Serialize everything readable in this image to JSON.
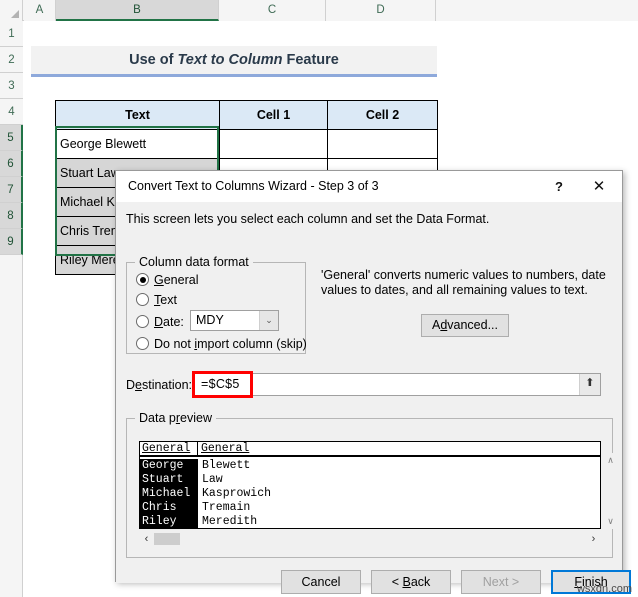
{
  "spreadsheet": {
    "column_headers": [
      "A",
      "B",
      "C",
      "D"
    ],
    "selected_column": "B",
    "row_headers": [
      "1",
      "2",
      "3",
      "4",
      "5",
      "6",
      "7",
      "8",
      "9"
    ],
    "selected_rows": [
      "5",
      "6",
      "7",
      "8",
      "9"
    ],
    "title_banner": {
      "prefix": "Use of ",
      "italic": "Text to Column",
      "suffix": " Feature"
    },
    "table": {
      "headers": [
        "Text",
        "Cell 1",
        "Cell 2"
      ],
      "rows": [
        {
          "text": "George Blewett",
          "cell1": "",
          "cell2": "",
          "selected": false
        },
        {
          "text": "Stuart Law",
          "cell1": "",
          "cell2": "",
          "selected": true
        },
        {
          "text": "Michael Kasprowich",
          "cell1": "",
          "cell2": "",
          "selected": true
        },
        {
          "text": "Chris Tremain",
          "cell1": "",
          "cell2": "",
          "selected": true
        },
        {
          "text": "Riley Meredith",
          "cell1": "",
          "cell2": "",
          "selected": true
        }
      ]
    }
  },
  "dialog": {
    "title": "Convert Text to Columns Wizard - Step 3 of 3",
    "help_icon": "?",
    "close_icon": "✕",
    "intro": "This screen lets you select each column and set the Data Format.",
    "column_data_format": {
      "legend": "Column data format",
      "options": [
        {
          "label_before": "",
          "access_key": "G",
          "label_after": "eneral",
          "selected": true
        },
        {
          "label_before": "",
          "access_key": "T",
          "label_after": "ext",
          "selected": false
        },
        {
          "label_before": "",
          "access_key": "D",
          "label_after": "ate:",
          "selected": false
        },
        {
          "label_before": "Do not ",
          "access_key": "i",
          "label_after": "mport column (skip)",
          "selected": false
        }
      ],
      "date_format_value": "MDY",
      "date_format_arrow": "⌄"
    },
    "format_description": "'General' converts numeric values to numbers, date values to dates, and all remaining values to text.",
    "advanced_button": {
      "label_before": "A",
      "access_key": "d",
      "label_after": "vanced..."
    },
    "destination": {
      "label_before": "D",
      "access_key": "e",
      "label_after": "stination:",
      "value": "=$C$5",
      "picker_icon": "⬆",
      "highlight_color": "#ff0000"
    },
    "data_preview": {
      "legend_before": "Data p",
      "legend_key": "r",
      "legend_after": "eview",
      "column_headers": [
        "General",
        "General"
      ],
      "columns": [
        {
          "selected": true,
          "values": [
            "George",
            "Stuart",
            "Michael",
            "Chris",
            "Riley"
          ]
        },
        {
          "selected": false,
          "values": [
            "Blewett",
            "Law",
            "Kasprowich",
            "Tremain",
            "Meredith"
          ]
        }
      ],
      "scroll_up_icon": "∧",
      "scroll_down_icon": "∨",
      "scroll_left_icon": "‹",
      "scroll_right_icon": "›"
    },
    "buttons": {
      "cancel": "Cancel",
      "back_before": "< ",
      "back_key": "B",
      "back_after": "ack",
      "next": "Next >",
      "finish_before": "",
      "finish_key": "F",
      "finish_after": "inish",
      "next_disabled": true,
      "finish_default": true
    }
  },
  "watermark": "wsxdn.com",
  "colors": {
    "excel_green": "#217346",
    "table_header_fill": "#dbe9f6",
    "title_underline": "#8ea9db",
    "focus_blue": "#0078d7",
    "highlight_red": "#ff0000"
  }
}
